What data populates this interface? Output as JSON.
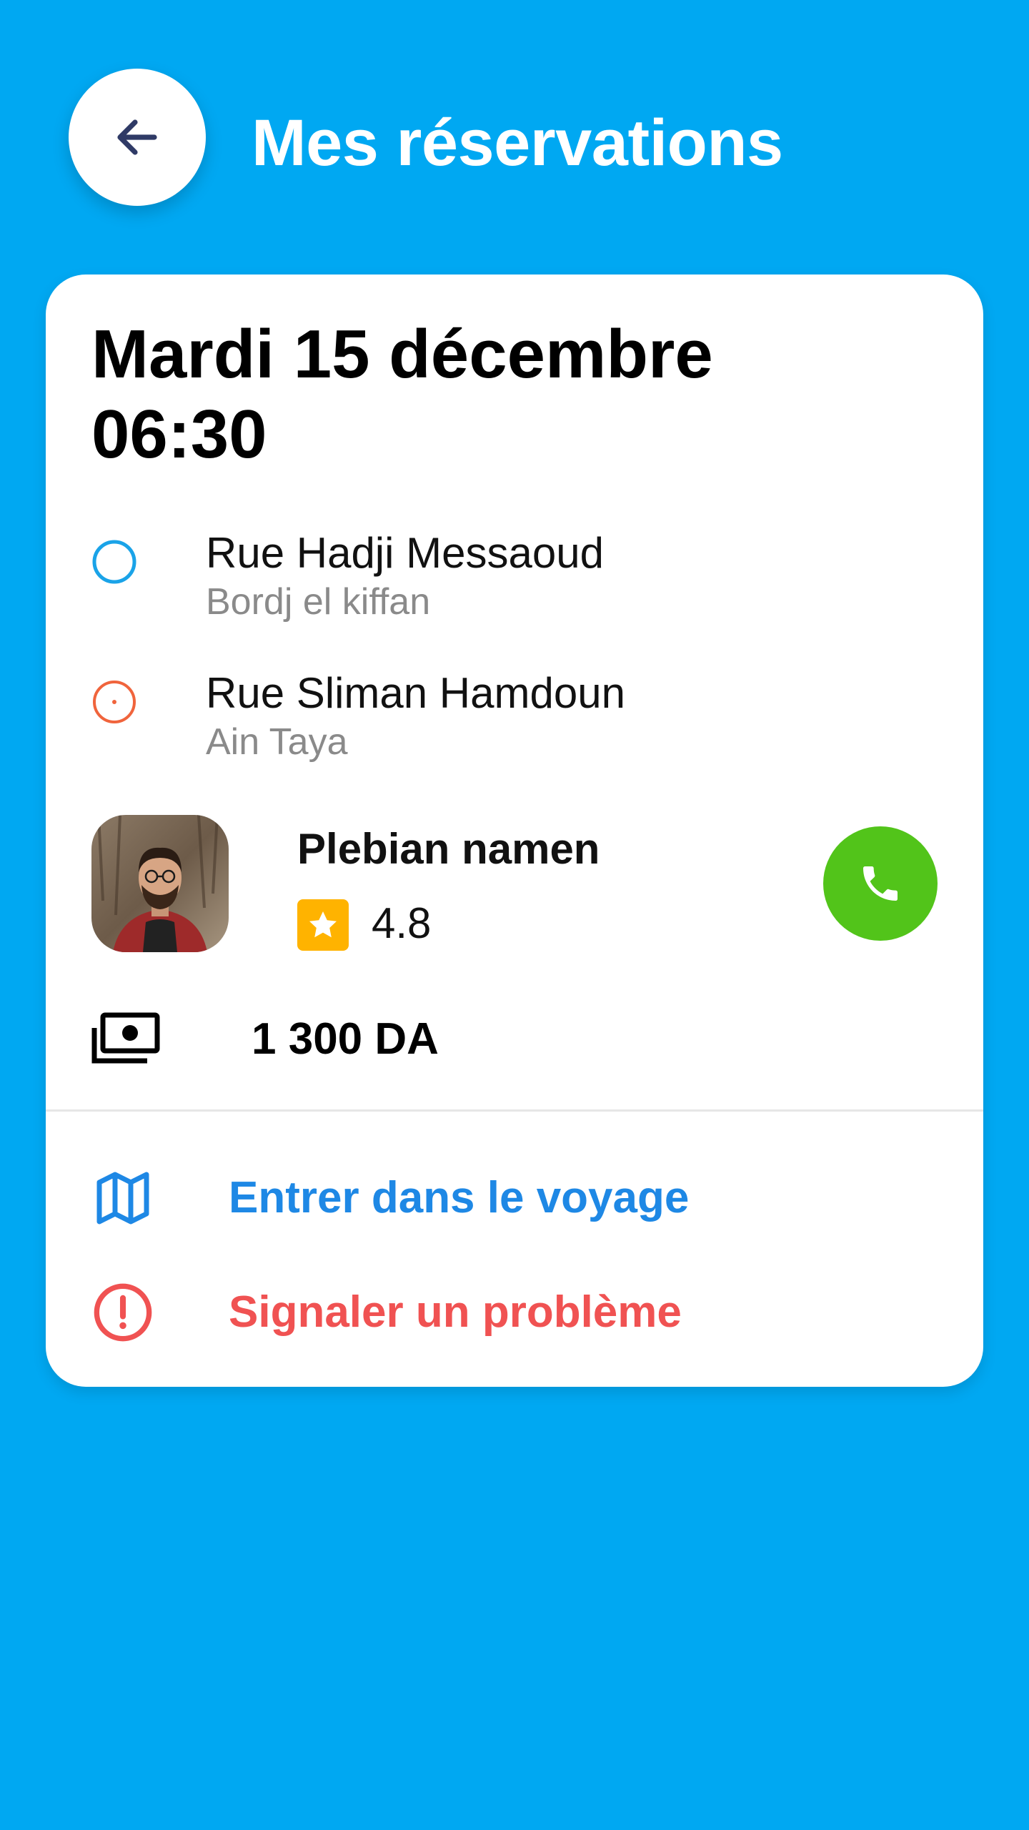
{
  "header": {
    "title": "Mes réservations",
    "back_icon": "arrow-left-icon"
  },
  "booking": {
    "date": "Mardi 15 décembre",
    "time": "06:30",
    "pickup": {
      "street": "Rue Hadji Messaoud",
      "area": "Bordj el kiffan",
      "marker_color": "#1AA3E8"
    },
    "dropoff": {
      "street": "Rue Sliman Hamdoun",
      "area": "Ain Taya",
      "marker_color": "#F0643C"
    },
    "driver": {
      "name": "Plebian namen",
      "rating": "4.8",
      "call_icon": "phone-icon"
    },
    "price": "1 300 DA",
    "actions": {
      "enter_trip": "Entrer dans le voyage",
      "report_problem": "Signaler un problème"
    }
  },
  "colors": {
    "background": "#00A8F2",
    "accent_blue": "#1E88E5",
    "danger_red": "#F05252",
    "call_green": "#52C41A",
    "star_amber": "#FFB300"
  }
}
